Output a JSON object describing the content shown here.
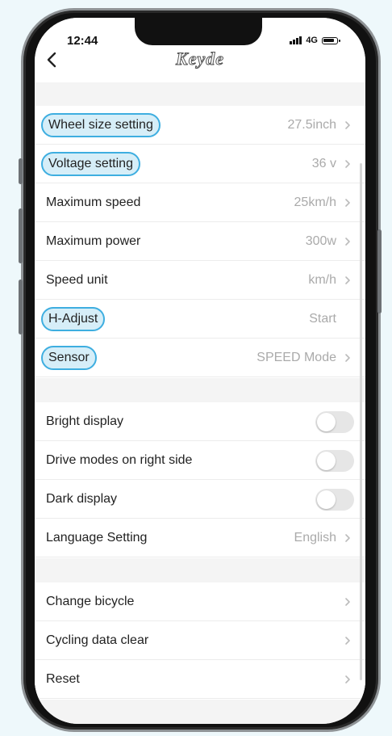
{
  "status_bar": {
    "time": "12:44",
    "network": "4G"
  },
  "header": {
    "title": "Keyde",
    "back_icon": "chevron-left-icon"
  },
  "settings": {
    "group1": [
      {
        "label": "Wheel size setting",
        "value": "27.5inch",
        "highlighted": true,
        "chevron": true
      },
      {
        "label": "Voltage setting",
        "value": "36 v",
        "highlighted": true,
        "chevron": true
      },
      {
        "label": "Maximum speed",
        "value": "25km/h",
        "highlighted": false,
        "chevron": true
      },
      {
        "label": "Maximum power",
        "value": "300w",
        "highlighted": false,
        "chevron": true
      },
      {
        "label": "Speed unit",
        "value": "km/h",
        "highlighted": false,
        "chevron": true
      },
      {
        "label": "H-Adjust",
        "value": "Start",
        "highlighted": true,
        "chevron": false
      },
      {
        "label": "Sensor",
        "value": "SPEED Mode",
        "highlighted": true,
        "chevron": true
      }
    ],
    "group2": [
      {
        "label": "Bright display",
        "toggle": false
      },
      {
        "label": "Drive modes on right side",
        "toggle": false
      },
      {
        "label": "Dark display",
        "toggle": false
      },
      {
        "label": "Language Setting",
        "value": "English",
        "chevron": true
      }
    ],
    "group3": [
      {
        "label": "Change bicycle",
        "chevron": true
      },
      {
        "label": "Cycling data clear",
        "chevron": true
      },
      {
        "label": "Reset",
        "chevron": true
      }
    ]
  },
  "colors": {
    "highlight_border": "#3eaee0",
    "highlight_fill": "#d6eef8",
    "toggle_off": "#e6e6e6"
  }
}
